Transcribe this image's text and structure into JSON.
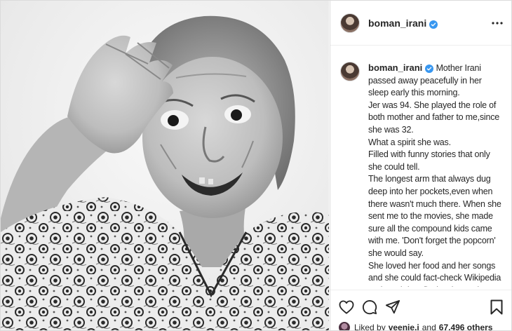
{
  "post": {
    "username": "boman_irani",
    "verified": true,
    "more_icon": "more-horizontal-icon"
  },
  "caption": {
    "username": "boman_irani",
    "lines": [
      "Mother Irani passed away peacefully in her sleep early this morning.",
      "Jer was 94. She played the role of both mother and father to me,since she was 32.",
      "What a spirit she was.",
      "Filled with funny stories that only she could tell.",
      "The longest arm that always dug deep into her pockets,even when there wasn't much there. When she sent me to the movies, she made sure all the compound kids came with me. 'Don't forget the popcorn' she would say.",
      "She loved her food and her songs and she could fact-check Wikipedia and IMDb in a flash. Sharp, sharp, sharp, till the very end."
    ]
  },
  "actions": {
    "like_icon": "heart-icon",
    "comment_icon": "comment-icon",
    "share_icon": "share-icon",
    "save_icon": "bookmark-icon"
  },
  "likes": {
    "prefix": "Liked by",
    "liker": "veenie.j",
    "conjunction": "and",
    "others": "67,496 others"
  },
  "colors": {
    "verified_badge": "#3897f0",
    "border": "#dbdbdb",
    "text": "#262626"
  }
}
